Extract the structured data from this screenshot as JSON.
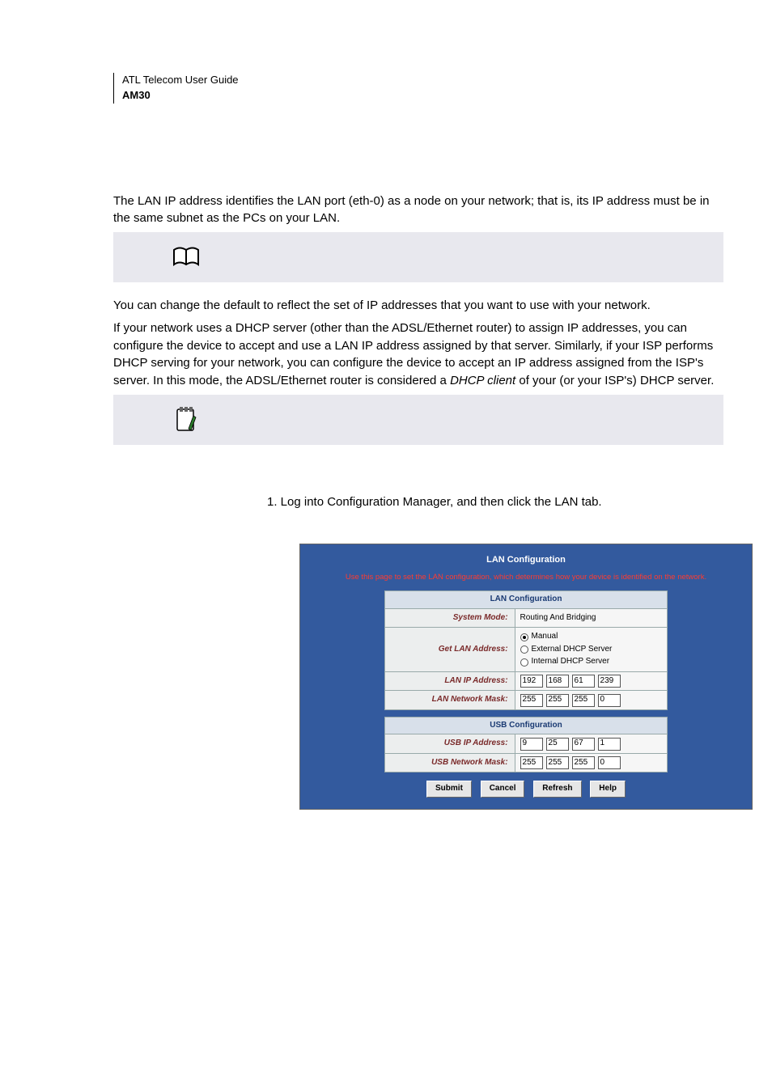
{
  "header": {
    "line1": "ATL Telecom User Guide",
    "line2": "AM30"
  },
  "para1": "The LAN IP address identifies the LAN port (eth-0) as a node on your network; that is, its IP address must be in the same subnet as the PCs on your LAN.",
  "para2": "You can change the default to reflect the set of IP addresses that you want to use with your network.",
  "para3": "If your network uses a DHCP server (other than the ADSL/Ethernet router) to assign IP addresses, you can configure the device to accept and use a LAN IP address assigned by that server. Similarly, if your ISP performs DHCP serving for your network, you can configure the device to accept an IP address assigned from the ISP's server. In this mode, the ADSL/Ethernet router is considered a ",
  "para3_em": "DHCP client",
  "para3_tail": " of your (or your ISP's) DHCP server.",
  "step1": "1.   Log into Configuration Manager, and then click the LAN tab.",
  "panel": {
    "title": "LAN Configuration",
    "note": "Use this page to set the LAN configuration, which determines how your device is identified on the network.",
    "lan_section": "LAN Configuration",
    "usb_section": "USB Configuration",
    "labels": {
      "system_mode": "System Mode:",
      "get_lan": "Get LAN Address:",
      "lan_ip": "LAN IP Address:",
      "lan_mask": "LAN Network Mask:",
      "usb_ip": "USB IP Address:",
      "usb_mask": "USB Network Mask:"
    },
    "system_mode_value": "Routing And Bridging",
    "radio_opts": {
      "manual": "Manual",
      "external": "External DHCP Server",
      "internal": "Internal DHCP Server"
    },
    "lan_ip": [
      "192",
      "168",
      "61",
      "239"
    ],
    "lan_mask": [
      "255",
      "255",
      "255",
      "0"
    ],
    "usb_ip": [
      "9",
      "25",
      "67",
      "1"
    ],
    "usb_mask": [
      "255",
      "255",
      "255",
      "0"
    ],
    "buttons": {
      "submit": "Submit",
      "cancel": "Cancel",
      "refresh": "Refresh",
      "help": "Help"
    }
  }
}
